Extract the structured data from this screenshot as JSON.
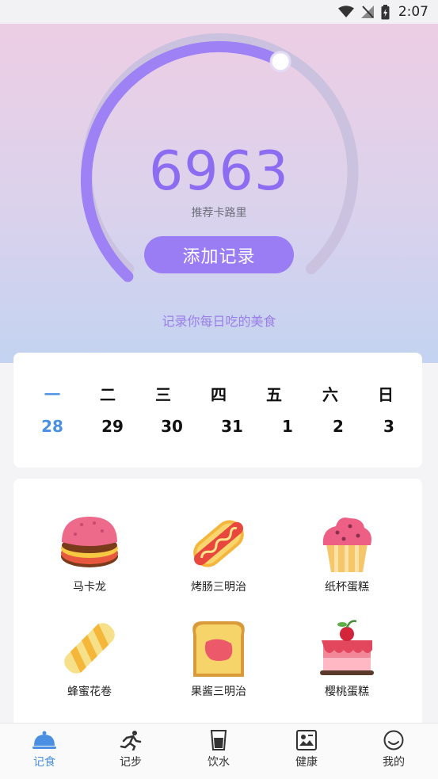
{
  "status_bar": {
    "time": "2:07"
  },
  "calorie": {
    "value": "6963",
    "label": "推荐卡路里",
    "add_button": "添加记录",
    "subtitle": "记录你每日吃的美食",
    "progress_fraction": 0.6
  },
  "week": {
    "days": [
      "一",
      "二",
      "三",
      "四",
      "五",
      "六",
      "日"
    ],
    "dates": [
      "28",
      "29",
      "30",
      "31",
      "1",
      "2",
      "3"
    ],
    "selected_index": 0
  },
  "foods": [
    {
      "label": "马卡龙",
      "icon": "macaron-icon"
    },
    {
      "label": "烤肠三明治",
      "icon": "hotdog-icon"
    },
    {
      "label": "纸杯蛋糕",
      "icon": "cupcake-icon"
    },
    {
      "label": "蜂蜜花卷",
      "icon": "honey-roll-icon"
    },
    {
      "label": "果酱三明治",
      "icon": "jam-sandwich-icon"
    },
    {
      "label": "樱桃蛋糕",
      "icon": "cherry-cake-icon"
    }
  ],
  "tabs": [
    {
      "label": "记食",
      "icon": "food-cloche-icon",
      "active": true
    },
    {
      "label": "记步",
      "icon": "running-icon",
      "active": false
    },
    {
      "label": "饮水",
      "icon": "water-cup-icon",
      "active": false
    },
    {
      "label": "健康",
      "icon": "health-card-icon",
      "active": false
    },
    {
      "label": "我的",
      "icon": "smile-icon",
      "active": false
    }
  ],
  "colors": {
    "accent_purple": "#8d6cf2",
    "button_purple": "#9a7cf4",
    "active_blue": "#4a90e2"
  }
}
